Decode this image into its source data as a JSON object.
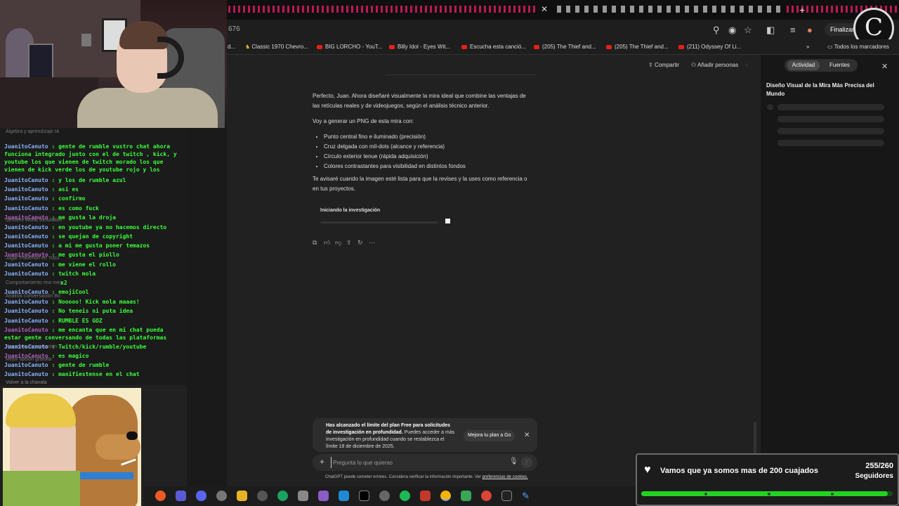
{
  "browser": {
    "url_fragment": "676",
    "finalize_button": "Finalizar a",
    "bookmarks": [
      {
        "label": "d..."
      },
      {
        "label": "Classic 1970 Chevro..."
      },
      {
        "label": "BIG LORCHO - YouT..."
      },
      {
        "label": "Billy Idol - Eyes Wit..."
      },
      {
        "label": "Escucha esta canció..."
      },
      {
        "label": "(205) The Thief and..."
      },
      {
        "label": "(205) The Thief and..."
      },
      {
        "label": "(211) Odyssey Of Li..."
      }
    ],
    "all_bookmarks": "Todos los marcadores"
  },
  "chat_header": {
    "share": "Compartir",
    "add_people": "Añadir personas"
  },
  "side_panel": {
    "tab_activity": "Actividad",
    "tab_sources": "Fuentes",
    "title": "Diseño Visual de la Mira Más Precisa del Mundo"
  },
  "message": {
    "p1": "Perfecto, Juan. Ahora diseñaré visualmente la mira ideal que combine las ventajas de las retículas reales y de videojuegos, según el análisis técnico anterior.",
    "p2": "Voy a generar un PNG de esta mira con:",
    "bullets": [
      "Punto central fino e iluminado (precisión)",
      "Cruz delgada con mil-dots (alcance y referencia)",
      "Círculo exterior tenue (rápida adquisición)",
      "Colores contrastantes para visibilidad en distintos fondos"
    ],
    "p3": "Te avisaré cuando la imagen esté lista para que la revises y la uses como referencia o en tus proyectos."
  },
  "research_status": "Iniciando la investigación",
  "limit_banner": {
    "bold": "Has alcanzado el límite del plan Free para solicitudes de investigación en profundidad.",
    "text": " Puedes acceder a más investigación en profundidad cuando se restablezca el límite 18 de diciembre de 2025.",
    "upgrade": "Mejora tu plan a Go"
  },
  "composer": {
    "placeholder": "Pregunta lo que quieras"
  },
  "disclaimer": {
    "text": "ChatGPT puede cometer errores. Considera verificar la información importante. Ver ",
    "link": "preferencias de cookies."
  },
  "stream_chat": {
    "ghost_items": [
      "Álgebra y aprendizaje IA",
      "Sentient World Simulation",
      "Jugar Pokémon en Yuzu",
      "Comportamiento rino mira",
      "Análisis conversación Bo",
      "Resumen conversación",
      "Mejor opción gratuita"
    ],
    "lines": [
      {
        "user": "JuanitoCanuto",
        "text": " : gente de rumble vustro chat ahora funciona integrado junto con el de twitch , kick, y youtube los que vienen de twitch morado los que vienen de kick verde los de youtube rojo y los"
      },
      {
        "user": "JuanitoCanuto",
        "text": " : y los de rumble azul"
      },
      {
        "user": "JuanitoCanuto",
        "text": " : asi es"
      },
      {
        "user": "JuanitoCanuto",
        "text": " : confirmo"
      },
      {
        "user": "JuanitoCanuto",
        "text": " : es como fuck"
      },
      {
        "user": "JuanitoCanuto",
        "text": " : me gusta la droja",
        "purple": true
      },
      {
        "user": "JuanitoCanuto",
        "text": " : en youtube ya no hacemos directo"
      },
      {
        "user": "JuanitoCanuto",
        "text": " : se quejan de copyright"
      },
      {
        "user": "JuanitoCanuto",
        "text": " : a mi me gusta poner temazos"
      },
      {
        "user": "JuanitoCanuto",
        "text": " : me gusta el piollo",
        "purple": true
      },
      {
        "user": "JuanitoCanuto",
        "text": " : me viene el rollo"
      },
      {
        "user": "JuanitoCanuto",
        "text": " : twitch mola"
      },
      {
        "user": "",
        "text": "x2"
      },
      {
        "user": "JuanitoCanuto",
        "text": " : emojiCool"
      },
      {
        "user": "JuanitoCanuto",
        "text": " : Nooooo! Kick mola maaas!"
      },
      {
        "user": "JuanitoCanuto",
        "text": " : No teneis ni puta idea"
      },
      {
        "user": "JuanitoCanuto",
        "text": " : RUMBLE ES GOZ"
      },
      {
        "user": "JuanitoCanuto",
        "text": " : me encanta que en mi chat pueda estar gente conversando de todas las plataformas",
        "purple": true
      },
      {
        "user": "JuanitoCanuto",
        "text": " : Twitch/kick/rumble/youtube"
      },
      {
        "user": "JuanitoCanuto",
        "text": " : es magico",
        "purple": true
      },
      {
        "user": "JuanitoCanuto",
        "text": " : gente de rumble"
      },
      {
        "user": "JuanitoCanuto",
        "text": " : manifiestense en el chat"
      }
    ],
    "back_link": "Volver a la chavala"
  },
  "follower_goal": {
    "title": "Vamos que ya somos mas de 200 cuajados",
    "count": "255/260",
    "label": "Seguidores",
    "progress": 0.98
  },
  "colors": {
    "twitch": "#b060c0",
    "kick": "#39ff39",
    "rumble": "#8ab4ff",
    "goal_bar": "#22d322"
  }
}
